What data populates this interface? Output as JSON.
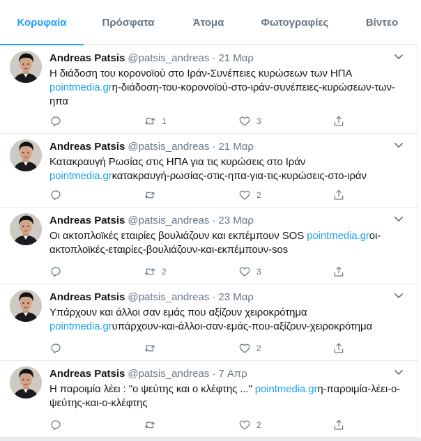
{
  "tabs": [
    {
      "label": "Κορυφαία",
      "active": true
    },
    {
      "label": "Πρόσφατα",
      "active": false
    },
    {
      "label": "Άτομα",
      "active": false
    },
    {
      "label": "Φωτογραφίες",
      "active": false
    },
    {
      "label": "Βίντεο",
      "active": false
    }
  ],
  "colors": {
    "accent": "#1da1f2",
    "muted": "#657786",
    "text": "#14171a",
    "border": "#e6ecf0"
  },
  "icons": {
    "reply": "reply-icon",
    "retweet": "retweet-icon",
    "like": "heart-icon",
    "share": "share-icon",
    "menu": "chevron-down-icon"
  },
  "tweets": [
    {
      "name": "Andreas Patsis",
      "handle": "@patsis_andreas",
      "sep": "·",
      "date": "21 Μαρ",
      "text": "Η διάδοση του κορονοϊού στο Ιράν-Συνέπειες κυρώσεων των ΗΠΑ ",
      "link": "pointmedia.gr",
      "link_tail": "η-διάδοση-του-κορονοϊού-στο-ιράν-συνέπειες-κυρώσεων-των-ηπα",
      "retweets": "1",
      "likes": "3"
    },
    {
      "name": "Andreas Patsis",
      "handle": "@patsis_andreas",
      "sep": "·",
      "date": "21 Μαρ",
      "text": "Κατακραυγή Ρωσίας στις ΗΠΑ για τις κυρώσεις στο Ιράν ",
      "link": "pointmedia.gr",
      "link_tail": "κατακραυγή-ρωσίας-στις-ηπα-για-τις-κυρώσεις-στο-ιράν",
      "retweets": "",
      "likes": "2"
    },
    {
      "name": "Andreas Patsis",
      "handle": "@patsis_andreas",
      "sep": "·",
      "date": "23 Μαρ",
      "text": "Οι ακτοπλοϊκές εταιρίες βουλιάζουν και εκπέμπουν SOS ",
      "link": "pointmedia.gr",
      "link_tail": "οι-ακτοπλοϊκές-εταιρίες-βουλιάζουν-και-εκπέμπουν-sos",
      "retweets": "2",
      "likes": "3"
    },
    {
      "name": "Andreas Patsis",
      "handle": "@patsis_andreas",
      "sep": "·",
      "date": "23 Μαρ",
      "text": "Υπάρχουν και άλλοι σαν εμάς που αξίζουν χειροκρότημα ",
      "link": "pointmedia.gr",
      "link_tail": "υπάρχουν-και-άλλοι-σαν-εμάς-που-αξίζουν-χειροκρότημα",
      "retweets": "",
      "likes": "2"
    },
    {
      "name": "Andreas Patsis",
      "handle": "@patsis_andreas",
      "sep": "·",
      "date": "7 Απρ",
      "text": "Η παροιμία λέει : \"ο ψεύτης και ο κλέφτης ...\" ",
      "link": "pointmedia.gr",
      "link_tail": "η-παροιμία-λέει-ο-ψεύτης-και-ο-κλέφτης",
      "retweets": "",
      "likes": "2"
    }
  ]
}
